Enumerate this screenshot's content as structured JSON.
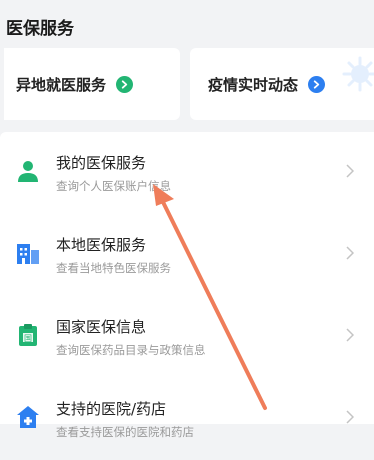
{
  "section": {
    "title": "医保服务"
  },
  "cards": [
    {
      "label": "异地就医服务",
      "icon": "arrow-right-circle-icon",
      "color": "#22b573"
    },
    {
      "label": "疫情实时动态",
      "icon": "arrow-right-circle-icon",
      "color": "#2d7ff0"
    }
  ],
  "list": [
    {
      "title": "我的医保服务",
      "subtitle": "查询个人医保账户信息",
      "icon": "person-icon",
      "color": "#22b573"
    },
    {
      "title": "本地医保服务",
      "subtitle": "查看当地特色医保服务",
      "icon": "building-icon",
      "color": "#2d7ff0"
    },
    {
      "title": "国家医保信息",
      "subtitle": "查询医保药品目录与政策信息",
      "icon": "clipboard-icon",
      "color": "#22b573"
    },
    {
      "title": "支持的医院/药店",
      "subtitle": "查看支持医保的医院和药店",
      "icon": "hospital-icon",
      "color": "#2d7ff0"
    }
  ],
  "annotation": {
    "arrow_color": "#ef7d5a"
  }
}
